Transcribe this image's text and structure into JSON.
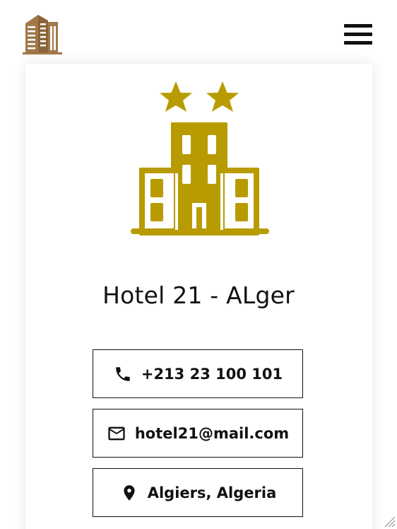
{
  "colors": {
    "logo_brown": "#A0784A",
    "hotel_gold": "#B89B00",
    "text_dark": "#111111"
  },
  "header": {
    "logo_icon": "building-logo-icon",
    "menu_icon": "hamburger-menu-icon"
  },
  "hotel": {
    "illustration_icon": "two-star-hotel-icon",
    "name": "Hotel 21 - ALger"
  },
  "contacts": {
    "phone": {
      "icon": "phone-icon",
      "label": "+213 23 100 101"
    },
    "email": {
      "icon": "mail-icon",
      "label": "hotel21@mail.com"
    },
    "location": {
      "icon": "location-pin-icon",
      "label": "Algiers, Algeria"
    }
  }
}
